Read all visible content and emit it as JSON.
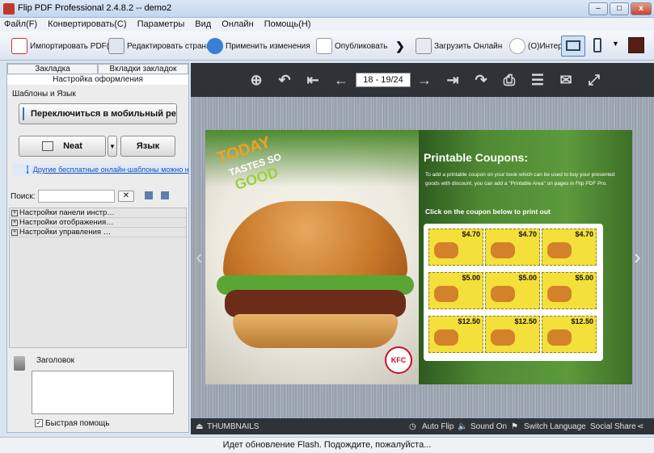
{
  "window": {
    "title": "Flip PDF Professional 2.4.8.2 -- demo2"
  },
  "menu": [
    "Файл(F)",
    "Конвертировать(C)",
    "Параметры",
    "Вид",
    "Онлайн",
    "Помощь(H)"
  ],
  "toolbar": {
    "import": "Импортировать PDF(I)",
    "edit": "Редактировать страниць",
    "apply": "Применить изменения",
    "publish": "Опубликовать",
    "upload": "Загрузить Онлайн",
    "internet": "(O)Интер"
  },
  "leftpanel": {
    "tabs": [
      "Закладка",
      "Вкладки закладок"
    ],
    "section": "Настройка оформления",
    "templates_label": "Шаблоны и Язык",
    "mobile_button": "Переключиться в мобильный режи",
    "theme_button": "Neat",
    "lang_button": "Язык",
    "link": "Другие бесплатные онлайн-шаблоны можно н",
    "search_label": "Поиск:",
    "search_value": "",
    "tree": [
      "Настройки панели инстр…",
      "Настройки отображения…",
      "Настройки управления …"
    ],
    "heading_label": "Заголовок",
    "help_checkbox": "Быстрая помощь"
  },
  "viewer": {
    "page": "18 - 19/24",
    "left_page": {
      "today": "TODAY",
      "tastes": "TASTES SO",
      "good": "GOOD",
      "kfc": "KFC"
    },
    "right_page": {
      "heading": "Printable Coupons:",
      "body": "To add a printable coupon on your book which can be used to buy your presented goods with discount, you can add a \"Printable Area\" on pages in Flip PDF Pro.",
      "cta": "Click on the coupon below to print out"
    },
    "coupon_prices": [
      "$4.70",
      "$4.70",
      "$4.70",
      "$5.00",
      "$5.00",
      "$5.00",
      "$12.50",
      "$12.50",
      "$12.50"
    ],
    "bottom": {
      "thumbnails": "THUMBNAILS",
      "autoflip": "Auto Flip",
      "sound": "Sound On",
      "language": "Switch Language",
      "share": "Social Share"
    }
  },
  "status": "Идет обновление Flash. Подождите, пожалуйста..."
}
